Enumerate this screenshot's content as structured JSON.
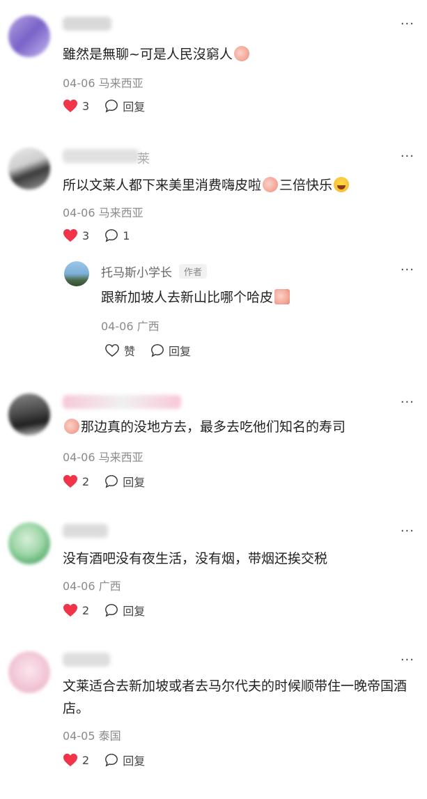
{
  "colors": {
    "heart": "#f2344a",
    "meta": "#8a8a8a",
    "text": "#222222"
  },
  "comments": [
    {
      "text_pre": "雖然是無聊~可是人民沒窮人",
      "text_post": "",
      "date": "04-06",
      "location": "马来西亚",
      "likes": "3",
      "reply_label": "回复"
    },
    {
      "text_pre": "所以文莱人都下来美里消费嗨皮啦",
      "text_mid": "三倍快乐",
      "date": "04-06",
      "location": "马来西亚",
      "likes": "3",
      "replies": "1",
      "name_visible": "莱"
    },
    {
      "reply_author": "托马斯小学长",
      "author_tag": "作者",
      "reply_text": "跟新加坡人去新山比哪个哈皮",
      "date": "04-06",
      "location": "广西",
      "like_label": "赞",
      "reply_label": "回复"
    },
    {
      "text_post": "那边真的没地方去，最多去吃他们知名的寿司",
      "date": "04-06",
      "location": "马来西亚",
      "likes": "2",
      "reply_label": "回复"
    },
    {
      "text": "没有酒吧没有夜生活，没有烟，带烟还挨交税",
      "date": "04-06",
      "location": "广西",
      "likes": "2",
      "reply_label": "回复"
    },
    {
      "text": "文莱适合去新加坡或者去马尔代夫的时候顺带住一晚帝国酒店。",
      "date": "04-05",
      "location": "泰国",
      "likes": "2",
      "reply_label": "回复"
    }
  ]
}
